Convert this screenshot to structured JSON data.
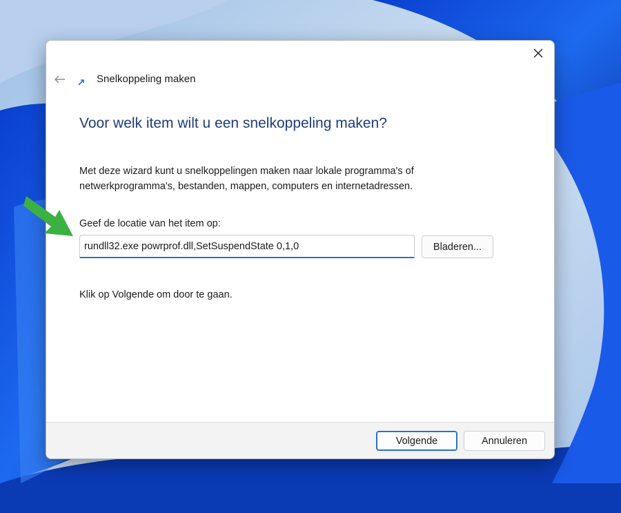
{
  "colors": {
    "heading": "#1f3a7a",
    "accent": "#2c6fc9",
    "arrow": "#3cb043"
  },
  "dialog": {
    "wizard_title": "Snelkoppeling maken",
    "heading": "Voor welk item wilt u een snelkoppeling maken?",
    "description_line1": "Met deze wizard kunt u snelkoppelingen maken naar lokale programma's of",
    "description_line2": "netwerkprogramma's, bestanden, mappen, computers en internetadressen.",
    "location_label": "Geef de locatie van het item op:",
    "location_value": "rundll32.exe powrprof.dll,SetSuspendState 0,1,0",
    "browse_label": "Bladeren...",
    "hint": "Klik op Volgende om door te gaan."
  },
  "footer": {
    "next_label": "Volgende",
    "cancel_label": "Annuleren"
  },
  "icons": {
    "close": "close-icon",
    "back": "back-arrow-icon",
    "shortcut": "shortcut-icon",
    "annotation": "green-arrow-icon"
  }
}
